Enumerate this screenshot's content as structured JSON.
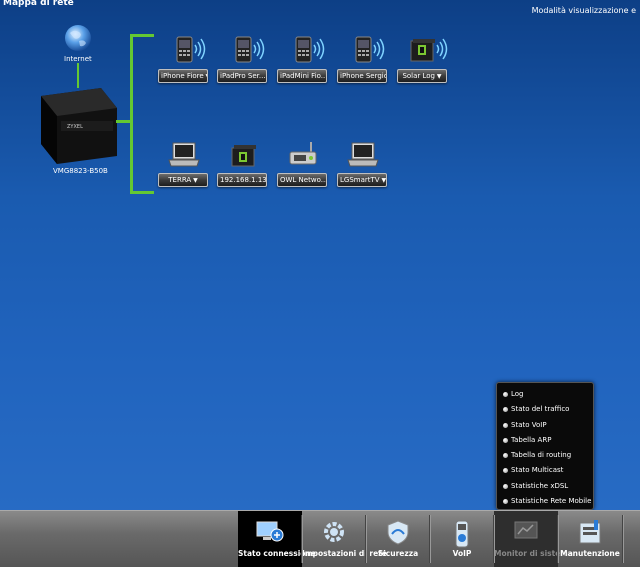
{
  "page_title": "Mappa di rete",
  "view_mode": "Modalità visualizzazione e",
  "internet_label": "Internet",
  "router_label": "VMG8823-B50B",
  "wireless_devices": [
    {
      "label": "iPhone Fiore",
      "has_menu": true
    },
    {
      "label": "iPadPro Ser...",
      "has_menu": false
    },
    {
      "label": "iPadMini Fio...",
      "has_menu": false
    },
    {
      "label": "iPhone Sergio",
      "has_menu": false
    },
    {
      "label": "Solar Log",
      "has_menu": true
    }
  ],
  "wired_devices": [
    {
      "label": "TERRA",
      "has_menu": true
    },
    {
      "label": "192.168.1.139",
      "has_menu": false
    },
    {
      "label": "OWL Netwo...",
      "has_menu": false
    },
    {
      "label": "LGSmartTV",
      "has_menu": true
    }
  ],
  "menu_arrow": "▼",
  "monitor_menu": [
    "Log",
    "Stato del traffico",
    "Stato VoIP",
    "Tabella ARP",
    "Tabella di routing",
    "Stato Multicast",
    "Statistiche xDSL",
    "Statistiche Rete Mobile"
  ],
  "tabs": [
    {
      "label": "Stato connessione",
      "state": "active"
    },
    {
      "label": "Impostazioni di rete",
      "state": "normal"
    },
    {
      "label": "Sicurezza",
      "state": "normal"
    },
    {
      "label": "VoIP",
      "state": "normal"
    },
    {
      "label": "Monitor di sistema",
      "state": "highlight"
    },
    {
      "label": "Manutenzione",
      "state": "normal"
    }
  ],
  "colors": {
    "link_line": "#64c832",
    "background": "#1a5bb0",
    "tab_active": "#000000"
  }
}
